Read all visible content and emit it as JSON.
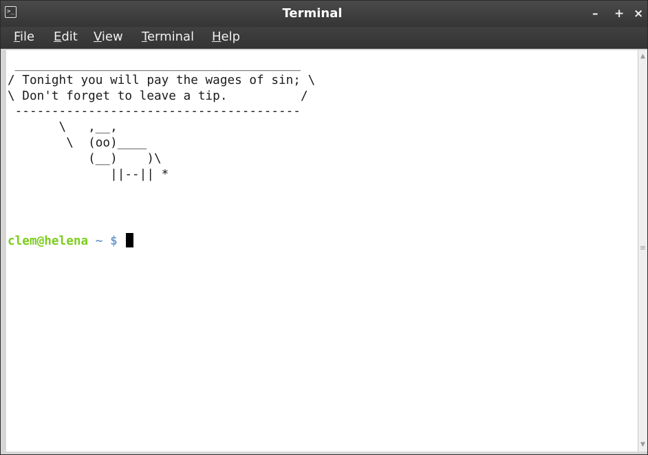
{
  "window": {
    "title": "Terminal",
    "icon": "terminal-icon",
    "icon_glyph": ">_",
    "controls": {
      "minimize": "–",
      "maximize": "+",
      "close": "×"
    }
  },
  "menu": [
    {
      "label": "File"
    },
    {
      "label": "Edit"
    },
    {
      "label": "View"
    },
    {
      "label": "Terminal"
    },
    {
      "label": "Help"
    }
  ],
  "terminal": {
    "output": " _______________________________________\n/ Tonight you will pay the wages of sin; \\\n\\ Don't forget to leave a tip.          /\n ---------------------------------------\n       \\   ,__,\n        \\  (oo)____\n           (__)    )\\\n              ||--|| *",
    "prompt_user": "clem@helena",
    "prompt_dir": " ~ $ ",
    "colors": {
      "user": "#7ccd1e",
      "dir": "#729fcf",
      "background": "#ffffff",
      "text": "#1a1a1a"
    }
  },
  "scrollbar": {
    "up_icon": "chevron-up-icon",
    "down_icon": "chevron-down-icon",
    "grip": "≡"
  }
}
